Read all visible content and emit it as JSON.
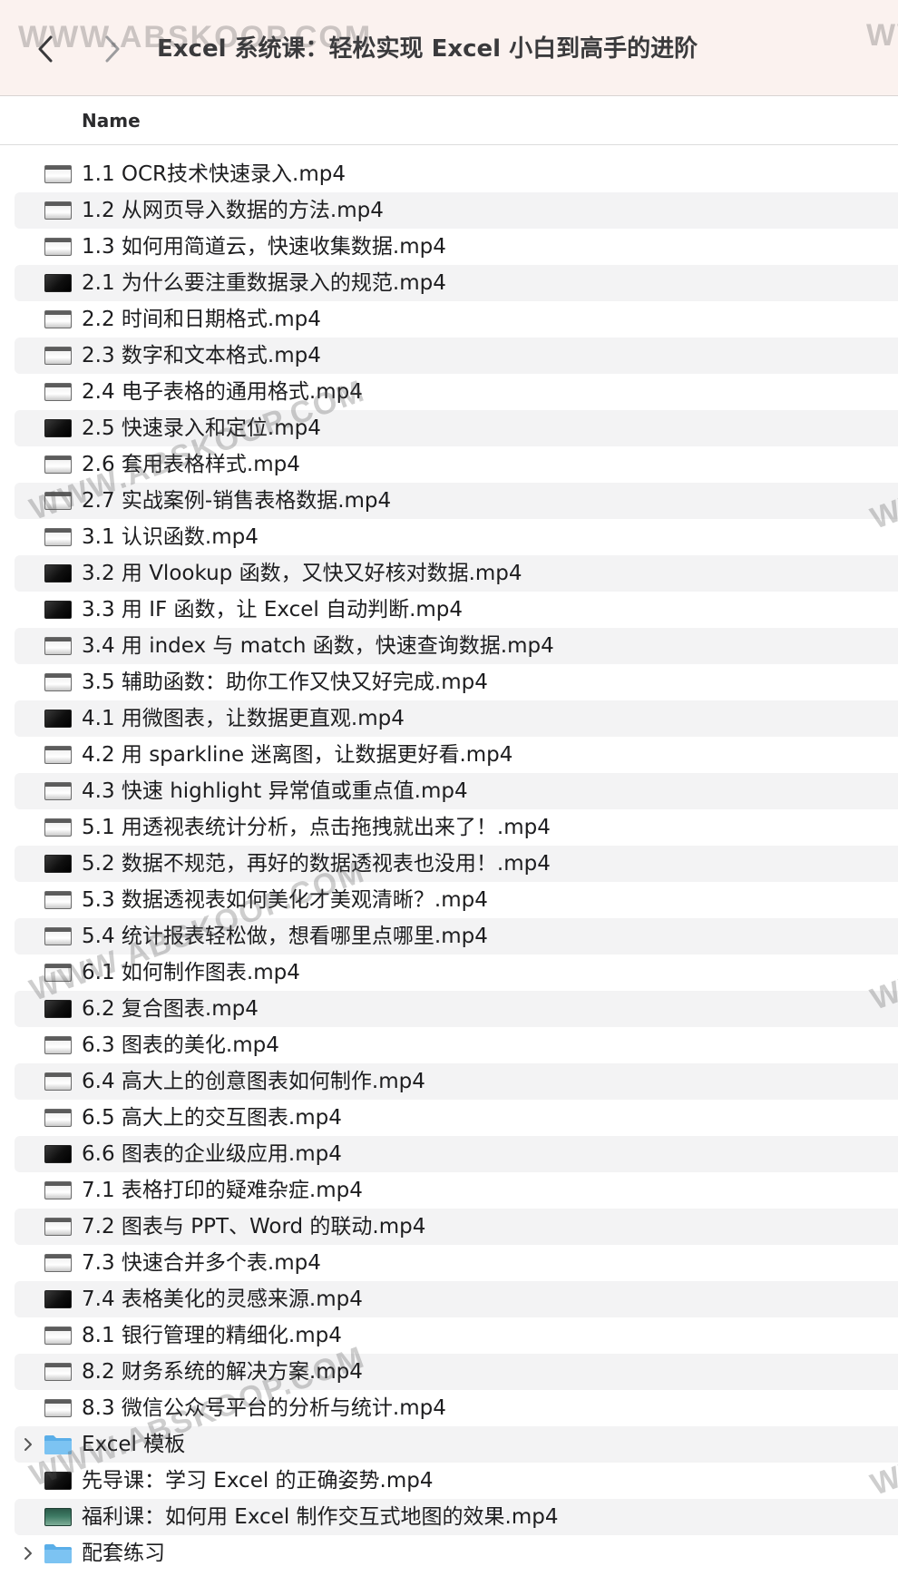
{
  "window": {
    "title": "Excel 系统课：轻松实现 Excel 小白到高手的进阶"
  },
  "list_header": {
    "name_column": "Name"
  },
  "rows": [
    {
      "label": "1.1 OCR技术快速录入.mp4",
      "kind": "video",
      "thumb": "light"
    },
    {
      "label": "1.2 从网页导入数据的方法.mp4",
      "kind": "video",
      "thumb": "light"
    },
    {
      "label": "1.3 如何用简道云，快速收集数据.mp4",
      "kind": "video",
      "thumb": "light"
    },
    {
      "label": "2.1 为什么要注重数据录入的规范.mp4",
      "kind": "video",
      "thumb": "dark"
    },
    {
      "label": "2.2 时间和日期格式.mp4",
      "kind": "video",
      "thumb": "light"
    },
    {
      "label": "2.3 数字和文本格式.mp4",
      "kind": "video",
      "thumb": "light"
    },
    {
      "label": "2.4 电子表格的通用格式.mp4",
      "kind": "video",
      "thumb": "light"
    },
    {
      "label": "2.5 快速录入和定位.mp4",
      "kind": "video",
      "thumb": "dark"
    },
    {
      "label": "2.6 套用表格样式.mp4",
      "kind": "video",
      "thumb": "light"
    },
    {
      "label": "2.7 实战案例-销售表格数据.mp4",
      "kind": "video",
      "thumb": "light"
    },
    {
      "label": "3.1 认识函数.mp4",
      "kind": "video",
      "thumb": "light"
    },
    {
      "label": "3.2 用 Vlookup 函数，又快又好核对数据.mp4",
      "kind": "video",
      "thumb": "dark"
    },
    {
      "label": "3.3 用 IF 函数，让 Excel 自动判断.mp4",
      "kind": "video",
      "thumb": "dark"
    },
    {
      "label": "3.4 用 index 与 match 函数，快速查询数据.mp4",
      "kind": "video",
      "thumb": "light"
    },
    {
      "label": "3.5 辅助函数：助你工作又快又好完成.mp4",
      "kind": "video",
      "thumb": "light"
    },
    {
      "label": "4.1 用微图表，让数据更直观.mp4",
      "kind": "video",
      "thumb": "dark"
    },
    {
      "label": "4.2 用 sparkline 迷离图，让数据更好看.mp4",
      "kind": "video",
      "thumb": "light"
    },
    {
      "label": "4.3 快速 highlight 异常值或重点值.mp4",
      "kind": "video",
      "thumb": "light"
    },
    {
      "label": "5.1 用透视表统计分析，点击拖拽就出来了！.mp4",
      "kind": "video",
      "thumb": "light"
    },
    {
      "label": "5.2 数据不规范，再好的数据透视表也没用！.mp4",
      "kind": "video",
      "thumb": "dark"
    },
    {
      "label": "5.3 数据透视表如何美化才美观清晰？.mp4",
      "kind": "video",
      "thumb": "light"
    },
    {
      "label": "5.4 统计报表轻松做，想看哪里点哪里.mp4",
      "kind": "video",
      "thumb": "light"
    },
    {
      "label": "6.1 如何制作图表.mp4",
      "kind": "video",
      "thumb": "light"
    },
    {
      "label": "6.2 复合图表.mp4",
      "kind": "video",
      "thumb": "dark"
    },
    {
      "label": "6.3 图表的美化.mp4",
      "kind": "video",
      "thumb": "light"
    },
    {
      "label": "6.4 高大上的创意图表如何制作.mp4",
      "kind": "video",
      "thumb": "light"
    },
    {
      "label": "6.5 高大上的交互图表.mp4",
      "kind": "video",
      "thumb": "light"
    },
    {
      "label": "6.6 图表的企业级应用.mp4",
      "kind": "video",
      "thumb": "dark"
    },
    {
      "label": "7.1 表格打印的疑难杂症.mp4",
      "kind": "video",
      "thumb": "light"
    },
    {
      "label": "7.2 图表与 PPT、Word 的联动.mp4",
      "kind": "video",
      "thumb": "light"
    },
    {
      "label": "7.3 快速合并多个表.mp4",
      "kind": "video",
      "thumb": "light"
    },
    {
      "label": "7.4 表格美化的灵感来源.mp4",
      "kind": "video",
      "thumb": "dark"
    },
    {
      "label": "8.1 银行管理的精细化.mp4",
      "kind": "video",
      "thumb": "light"
    },
    {
      "label": "8.2 财务系统的解决方案.mp4",
      "kind": "video",
      "thumb": "light"
    },
    {
      "label": "8.3 微信公众号平台的分析与统计.mp4",
      "kind": "video",
      "thumb": "light"
    },
    {
      "label": "Excel 模板",
      "kind": "folder",
      "thumb": "folder"
    },
    {
      "label": "先导课：学习 Excel 的正确姿势.mp4",
      "kind": "video",
      "thumb": "dark"
    },
    {
      "label": "福利课：如何用 Excel 制作交互式地图的效果.mp4",
      "kind": "video",
      "thumb": "green"
    },
    {
      "label": "配套练习",
      "kind": "folder",
      "thumb": "folder"
    }
  ],
  "watermark": {
    "text": "WWW.ABSKOOP.COM"
  },
  "colors": {
    "toolbar_bg": "#fbf2ef",
    "folder_blue": "#5aaee8",
    "stripe": "#f3f3f4"
  }
}
